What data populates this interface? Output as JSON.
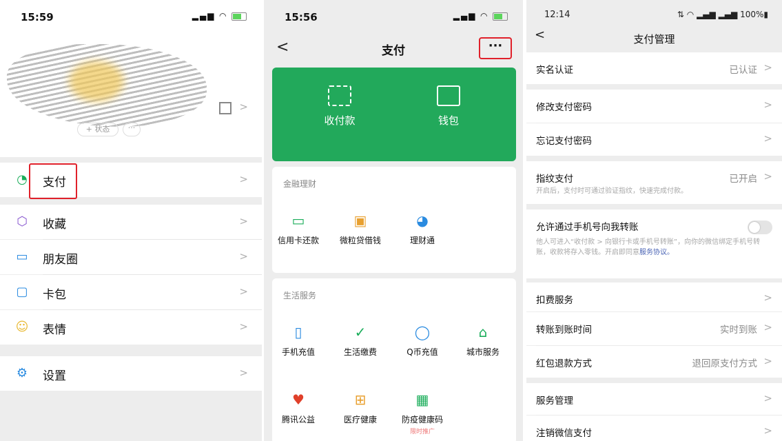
{
  "panel1": {
    "time": "15:59",
    "status_pill": "+ 状态",
    "dots_pill": "···",
    "menu": [
      {
        "label": "支付",
        "icon": "pay-icon"
      },
      {
        "label": "收藏",
        "icon": "favorites-icon"
      },
      {
        "label": "朋友圈",
        "icon": "moments-icon"
      },
      {
        "label": "卡包",
        "icon": "card-wallet-icon"
      },
      {
        "label": "表情",
        "icon": "emoji-icon"
      },
      {
        "label": "设置",
        "icon": "settings-icon"
      }
    ]
  },
  "panel2": {
    "time": "15:56",
    "title": "支付",
    "more": "···",
    "green": {
      "receive": "收付款",
      "wallet": "钱包"
    },
    "finance": {
      "title": "金融理财",
      "items": [
        {
          "label": "信用卡还款",
          "icon": "credit-card-icon",
          "color": "#1aad5a"
        },
        {
          "label": "微粒贷借钱",
          "icon": "loan-icon",
          "color": "#e8a030"
        },
        {
          "label": "理财通",
          "icon": "wealth-icon",
          "color": "#2a8be0"
        }
      ]
    },
    "life": {
      "title": "生活服务",
      "items": [
        {
          "label": "手机充值",
          "icon": "phone-topup-icon",
          "color": "#2a8be0"
        },
        {
          "label": "生活缴费",
          "icon": "utilities-icon",
          "color": "#1aad5a"
        },
        {
          "label": "Q币充值",
          "icon": "qcoin-icon",
          "color": "#2a8be0"
        },
        {
          "label": "城市服务",
          "icon": "city-service-icon",
          "color": "#1aad5a"
        },
        {
          "label": "腾讯公益",
          "icon": "charity-icon",
          "color": "#e0402a"
        },
        {
          "label": "医疗健康",
          "icon": "medical-icon",
          "color": "#e8a030"
        },
        {
          "label": "防疫健康码",
          "icon": "health-code-icon",
          "color": "#1aad5a",
          "sub": "限时推广"
        }
      ]
    }
  },
  "panel3": {
    "time": "12:14",
    "status_right": "100%",
    "title": "支付管理",
    "rows": {
      "realname": {
        "label": "实名认证",
        "value": "已认证"
      },
      "change_pwd": {
        "label": "修改支付密码"
      },
      "forgot_pwd": {
        "label": "忘记支付密码"
      },
      "fingerprint": {
        "label": "指纹支付",
        "value": "已开启",
        "desc": "开启后，支付时可通过验证指纹，快速完成付款。"
      },
      "phone_transfer": {
        "label": "允许通过手机号向我转账",
        "desc": "他人可进入“收付款 > 向银行卡或手机号转账”，向你的微信绑定手机号转账，收款将存入零钱。开启即同意",
        "link": "服务协议。"
      },
      "deduction": {
        "label": "扣费服务"
      },
      "arrival": {
        "label": "转账到账时间",
        "value": "实时到账"
      },
      "redpacket": {
        "label": "红包退款方式",
        "value": "退回原支付方式"
      },
      "service_mgmt": {
        "label": "服务管理"
      },
      "cancel": {
        "label": "注销微信支付"
      }
    }
  }
}
